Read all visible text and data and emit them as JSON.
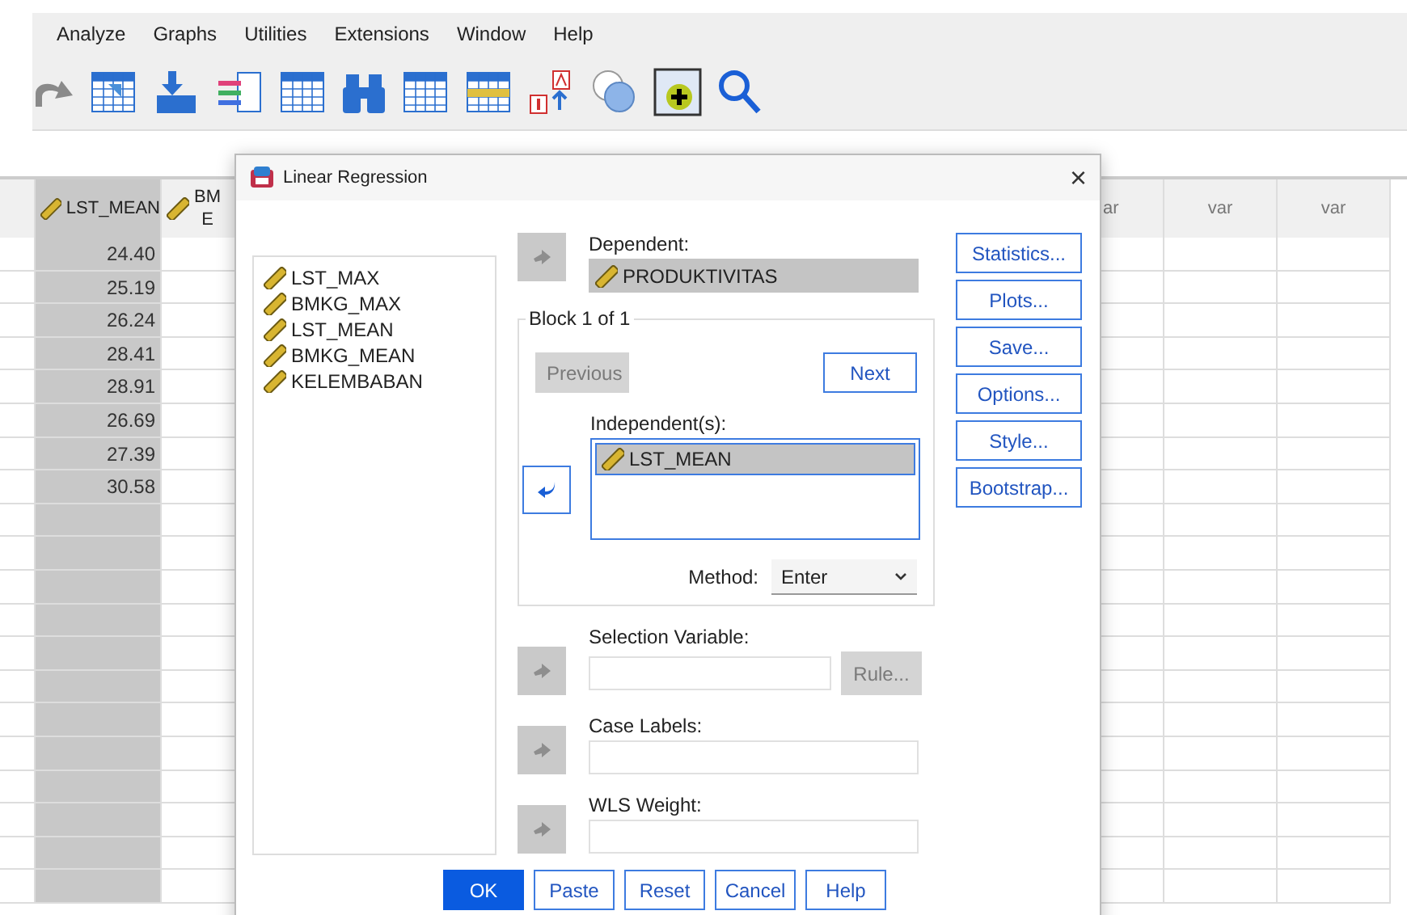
{
  "menu": [
    "Analyze",
    "Graphs",
    "Utilities",
    "Extensions",
    "Window",
    "Help"
  ],
  "grid": {
    "columns": [
      {
        "label": "LST_MEAN",
        "selected": true
      },
      {
        "label": "BM",
        "label_2": "E",
        "selected": false
      }
    ],
    "right_columns": [
      "ar",
      "var",
      "var"
    ],
    "values": [
      "24.40",
      "25.19",
      "26.24",
      "28.41",
      "28.91",
      "26.69",
      "27.39",
      "30.58"
    ]
  },
  "dialog": {
    "title": "Linear Regression",
    "close": "×",
    "variables": [
      "LST_MAX",
      "BMKG_MAX",
      "LST_MEAN",
      "BMKG_MEAN",
      "KELEMBABAN"
    ],
    "dependent": {
      "label": "Dependent:",
      "value": "PRODUKTIVITAS",
      "arrow": {
        "kind": "add",
        "disabled": true
      }
    },
    "block": {
      "label": "Block 1 of 1",
      "previous": {
        "label": "Previous",
        "disabled": true
      },
      "next": {
        "label": "Next",
        "disabled": false
      },
      "independent_label": "Independent(s):",
      "independents": [
        {
          "name": "LST_MEAN",
          "selected": true
        }
      ],
      "arrow": {
        "kind": "remove",
        "disabled": false
      },
      "method_label": "Method:",
      "method": "Enter"
    },
    "selection": {
      "label": "Selection Variable:",
      "arrow": {
        "kind": "add",
        "disabled": true
      },
      "rule": {
        "label": "Rule...",
        "disabled": true
      }
    },
    "case_labels": {
      "label": "Case Labels:",
      "arrow": {
        "kind": "add",
        "disabled": true
      }
    },
    "wls": {
      "label": "WLS Weight:",
      "arrow": {
        "kind": "add",
        "disabled": true
      }
    },
    "side_buttons": [
      "Statistics...",
      "Plots...",
      "Save...",
      "Options...",
      "Style...",
      "Bootstrap..."
    ],
    "buttons": [
      {
        "label": "OK",
        "kind": "primary"
      },
      {
        "label": "Paste",
        "kind": "normal"
      },
      {
        "label": "Reset",
        "kind": "normal"
      },
      {
        "label": "Cancel",
        "kind": "normal"
      },
      {
        "label": "Help",
        "kind": "normal"
      }
    ]
  }
}
